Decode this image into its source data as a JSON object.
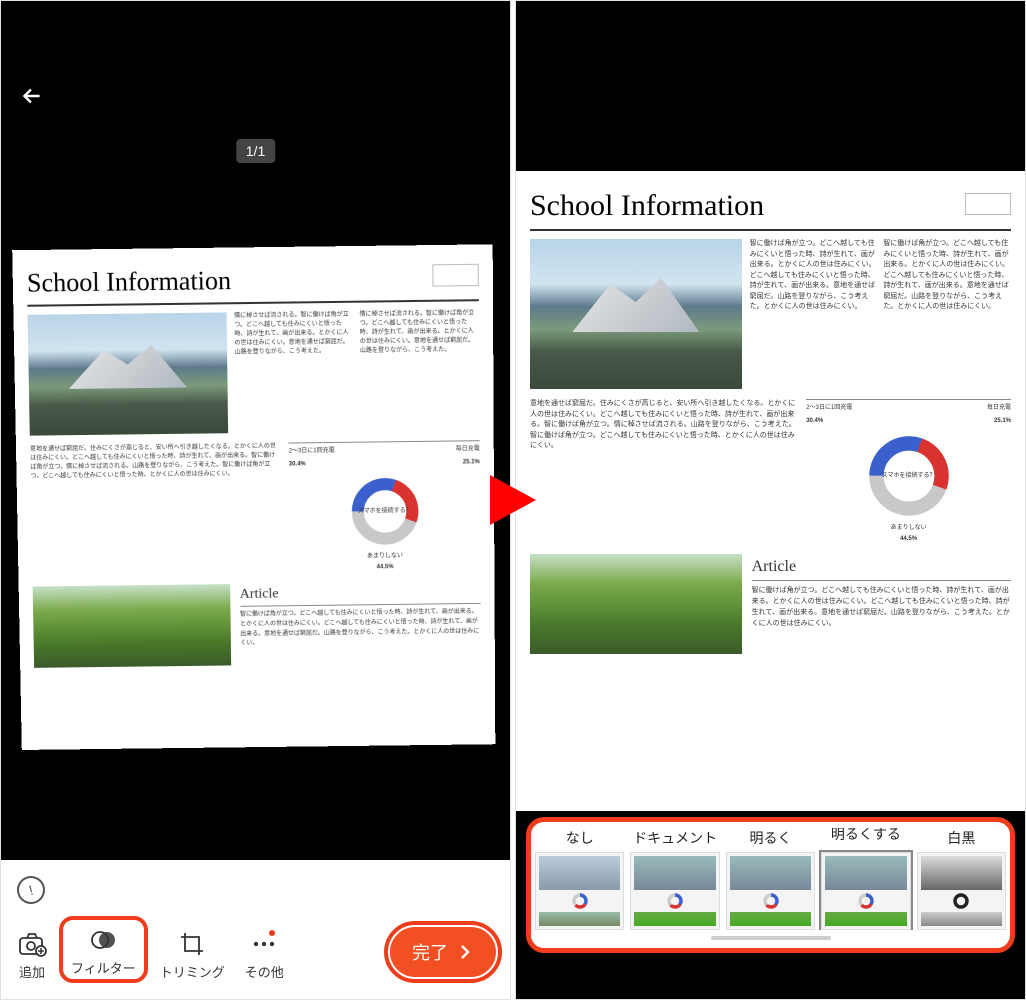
{
  "page_counter": "1/1",
  "toolbar": {
    "add": "追加",
    "filter": "フィルター",
    "crop": "トリミング",
    "more": "その他",
    "done": "完了"
  },
  "filters": {
    "none": "なし",
    "document": "ドキュメント",
    "brighten": "明るく",
    "brighten_more": "明るくする",
    "bw": "白黒"
  },
  "document": {
    "title": "School Information",
    "article_heading": "Article",
    "body_sample": "情に棹させば流される。智に働けば角が立つ。どこへ越しても住みにくいと悟った時、詩が生れて、画が出来る。とかくに人の世は住みにくい。意地を通せば窮屈だ。山路を登りながら、こう考えた。",
    "body_sample2": "智に働けば角が立つ。どこへ越しても住みにくいと悟った時、詩が生れて、画が出来る。とかくに人の世は住みにくい。どこへ越しても住みにくいと悟った時、詩が生れて、画が出来る。意地を通せば窮屈だ。山路を登りながら、こう考えた。とかくに人の世は住みにくい。",
    "body_sample3": "意地を通せば窮屈だ。住みにくさが高じると、安い所へ引き越したくなる。とかくに人の世は住みにくい。どこへ越しても住みにくいと悟った時、詩が生れて、画が出来る。智に働けば角が立つ。情に棹させば流される。山路を登りながら、こう考えた。智に働けば角が立つ。どこへ越しても住みにくいと悟った時、とかくに人の世は住みにくい。"
  },
  "chart_data": {
    "type": "pie",
    "title": "スマホを接続する？",
    "header_left": "2～3日に1回充電",
    "header_right": "毎日充電",
    "series": [
      {
        "name": "30.4%",
        "value": 30.4,
        "color": "#3b5fcd"
      },
      {
        "name": "25.1%",
        "value": 25.1,
        "color": "#d9322f"
      },
      {
        "name": "あまりしない 44.5%",
        "value": 44.5,
        "color": "#c8c8c8"
      }
    ],
    "labels": {
      "pct_a": "30.4%",
      "pct_b": "25.1%",
      "bottom_label": "あまりしない",
      "bottom_pct": "44.5%"
    }
  }
}
